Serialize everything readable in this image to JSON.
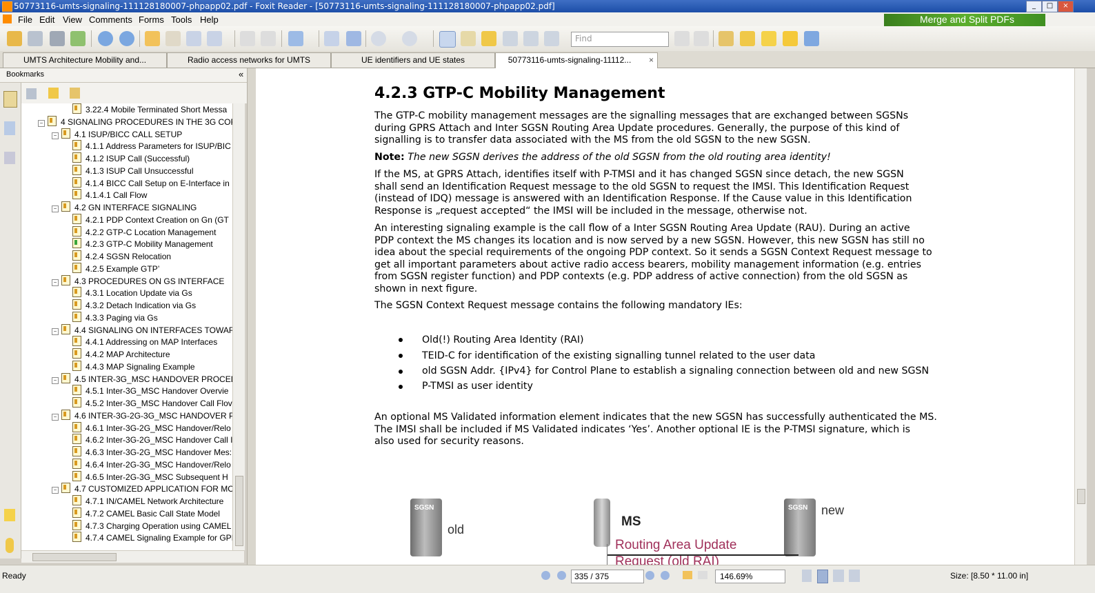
{
  "window": {
    "title": "50773116-umts-signaling-111128180007-phpapp02.pdf - Foxit Reader - [50773116-umts-signaling-111128180007-phpapp02.pdf]",
    "min_label": "_",
    "max_label": "□",
    "close_label": "×"
  },
  "menu": [
    "File",
    "Edit",
    "View",
    "Comments",
    "Forms",
    "Tools",
    "Help"
  ],
  "promo": "Merge and Split PDFs",
  "toolbar": {
    "find_placeholder": "Find"
  },
  "tabs": [
    {
      "label": "UMTS Architecture  Mobility and..."
    },
    {
      "label": "Radio access networks for UMTS"
    },
    {
      "label": "UE identifiers and UE states"
    },
    {
      "label": "50773116-umts-signaling-11112..."
    }
  ],
  "tab_close": "×",
  "bookmarks_title": "Bookmarks",
  "panel_collapse": "«",
  "bookmarks": [
    {
      "label": "3.22.4 Mobile Terminated Short Messa",
      "level": 3
    },
    {
      "label": "4 SIGNALING PROCEDURES IN THE 3G CORE",
      "level": 1
    },
    {
      "label": "4.1 ISUP/BICC CALL SETUP",
      "level": 2
    },
    {
      "label": "4.1.1 Address Parameters for ISUP/BIC",
      "level": 3
    },
    {
      "label": "4.1.2 ISUP Call (Successful)",
      "level": 3
    },
    {
      "label": "4.1.3 ISUP Call Unsuccessful",
      "level": 3
    },
    {
      "label": "4.1.4 BICC Call Setup on E-Interface in",
      "level": 3
    },
    {
      "label": "4.1.4.1 Call Flow",
      "level": 3
    },
    {
      "label": "4.2 GN INTERFACE SIGNALING",
      "level": 2
    },
    {
      "label": "4.2.1 PDP Context Creation on Gn (GT",
      "level": 3
    },
    {
      "label": "4.2.2 GTP-C Location Management",
      "level": 3
    },
    {
      "label": "4.2.3 GTP-C Mobility Management",
      "level": 3,
      "current": true
    },
    {
      "label": "4.2.4 SGSN Relocation",
      "level": 3
    },
    {
      "label": "4.2.5 Example GTP’",
      "level": 3
    },
    {
      "label": "4.3 PROCEDURES ON GS INTERFACE",
      "level": 2
    },
    {
      "label": "4.3.1 Location Update via Gs",
      "level": 3
    },
    {
      "label": "4.3.2 Detach Indication via Gs",
      "level": 3
    },
    {
      "label": "4.3.3 Paging via Gs",
      "level": 3
    },
    {
      "label": "4.4 SIGNALING ON INTERFACES TOWAR",
      "level": 2
    },
    {
      "label": "4.4.1 Addressing on MAP Interfaces",
      "level": 3
    },
    {
      "label": "4.4.2 MAP Architecture",
      "level": 3
    },
    {
      "label": "4.4.3 MAP Signaling Example",
      "level": 3
    },
    {
      "label": "4.5 INTER-3G_MSC HANDOVER PROCEDU",
      "level": 2
    },
    {
      "label": "4.5.1 Inter-3G_MSC Handover Overvie",
      "level": 3
    },
    {
      "label": "4.5.2 Inter-3G_MSC Handover Call Flov",
      "level": 3
    },
    {
      "label": "4.6 INTER-3G-2G-3G_MSC HANDOVER PR",
      "level": 2
    },
    {
      "label": "4.6.1 Inter-3G-2G_MSC Handover/Relo",
      "level": 3
    },
    {
      "label": "4.6.2 Inter-3G-2G_MSC Handover Call I",
      "level": 3
    },
    {
      "label": "4.6.3 Inter-3G-2G_MSC Handover Mes:",
      "level": 3
    },
    {
      "label": "4.6.4 Inter-2G-3G_MSC Handover/Relo",
      "level": 3
    },
    {
      "label": "4.6.5 Inter-2G-3G_MSC Subsequent H",
      "level": 3
    },
    {
      "label": "4.7 CUSTOMIZED APPLICATION FOR MOI",
      "level": 2
    },
    {
      "label": "4.7.1 IN/CAMEL Network Architecture",
      "level": 3
    },
    {
      "label": "4.7.2 CAMEL Basic Call State Model",
      "level": 3
    },
    {
      "label": "4.7.3 Charging Operation using CAMEL",
      "level": 3
    },
    {
      "label": "4.7.4 CAMEL Signaling Example for GPI",
      "level": 3
    }
  ],
  "document": {
    "heading": "4.2.3 GTP-C Mobility Management",
    "p1": [
      "The GTP-C mobility management messages are the signalling messages that are exchanged between SGSNs",
      "during GPRS Attach and Inter SGSN Routing Area Update procedures. Generally, the purpose of this kind of",
      "signalling is to transfer data associated with the MS from the old SGSN to the new SGSN."
    ],
    "note_label": "Note:",
    "note_text": "The new SGSN derives the address of the old SGSN from the old routing area identity!",
    "p2": [
      "If the MS, at GPRS Attach, identifies itself with P-TMSI and it has changed SGSN since detach, the new SGSN",
      "shall send an Identification Request message to the old SGSN to request the IMSI. This Identification Request",
      "(instead of IDQ) message is answered with an Identification Response. If the Cause value in this Identification",
      "Response is „request accepted“ the IMSI will be included in the message, otherwise not."
    ],
    "p3": [
      "An interesting signaling example is the call flow of a Inter SGSN Routing Area Update (RAU). During an active",
      "PDP context the MS changes its location and is now served by a new SGSN. However, this new SGSN has still no",
      "idea about the special requirements of the ongoing PDP context. So it sends a SGSN Context Request message to",
      "get all important parameters about active radio access bearers, mobility management information (e.g. entries",
      "from SGSN register function) and PDP contexts (e.g. PDP address of active connection) from the old SGSN as",
      "shown in next figure."
    ],
    "p4": "The SGSN Context Request message contains the following mandatory IEs:",
    "bullets": [
      "Old(!) Routing Area Identity (RAI)",
      "TEID-C for identification of the existing signalling tunnel related to the user data",
      "old SGSN Addr. {IPv4} for Control Plane to establish a signaling connection between old and new SGSN",
      "P-TMSI as user identity"
    ],
    "p5": [
      "An optional MS Validated information element indicates that the new SGSN has successfully authenticated the MS.",
      "The IMSI shall be included if MS Validated indicates ‘Yes’. Another optional IE is the P-TMSI signature, which is",
      "also used for security reasons."
    ],
    "figure": {
      "sgsn_badge": "SGSN",
      "old_label": "old",
      "new_label": "new",
      "ms_label": "MS",
      "msg1": "Routing Area Update",
      "msg2": "Request (old RAI)"
    }
  },
  "status": {
    "ready": "Ready",
    "page": "335 / 375",
    "zoom": "146.69%",
    "size": "Size: [8.50 * 11.00 in]"
  },
  "colors": {
    "accent": "#2a5caa",
    "promo": "#4a9a26",
    "figure_msg": "#a0305a"
  }
}
